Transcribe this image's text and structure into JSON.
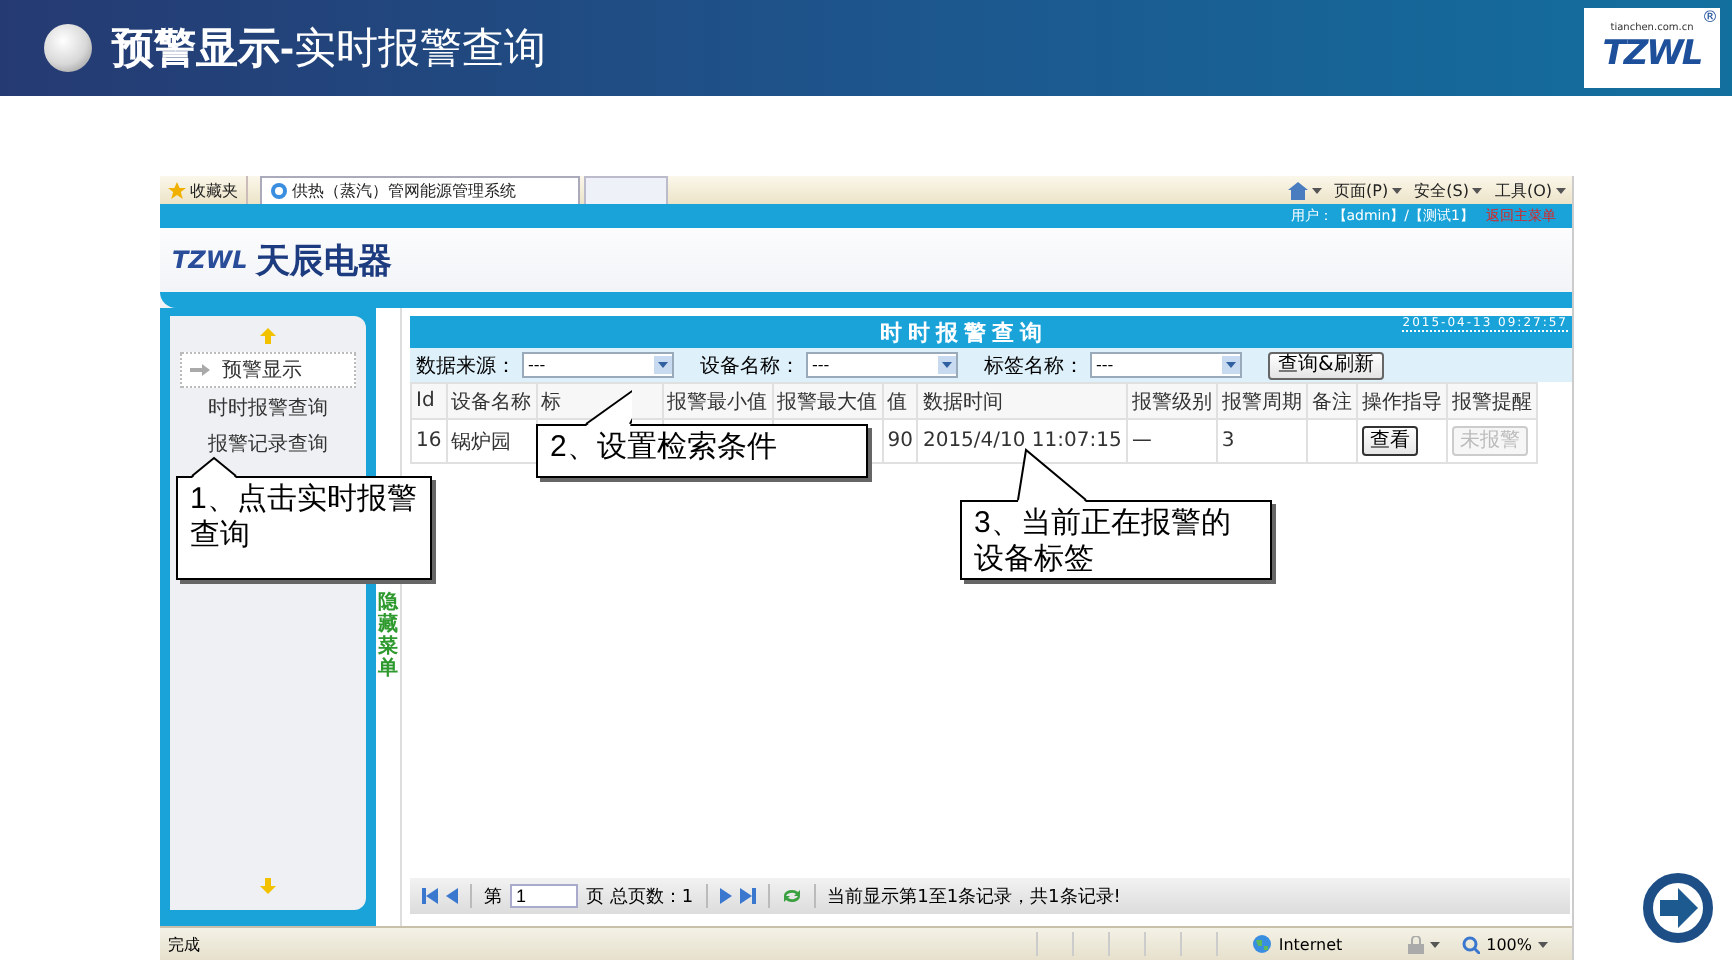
{
  "slide": {
    "title": "**预警显示-**实时报警查询",
    "logo": {
      "url": "tianchen.com.cn",
      "mark": "TZWL",
      "registered": "®"
    }
  },
  "browser": {
    "favorites": "收藏夹",
    "tab": {
      "title": "供热（蒸汽）管网能源管理系统",
      "selected": true
    },
    "menus": [
      "页面(P)",
      "安全(S)",
      "工具(O)"
    ],
    "status": "完成",
    "zone": "Internet",
    "zoom": "100%"
  },
  "app": {
    "logo_mark": "TZWL",
    "company": "天辰电器",
    "user": "用户：【admin】/【测试1】",
    "home_link": "返回主菜单",
    "sidebar": {
      "items": [
        {
          "label": "预警显示",
          "selected": true
        },
        {
          "label": "时时报警查询",
          "selected": false
        },
        {
          "label": "报警记录查询",
          "selected": false
        }
      ]
    },
    "hide_menu": "隐藏菜单",
    "panel": {
      "title": "时时报警查询",
      "timestamp": "2015-04-13 09:27:57",
      "filters": [
        {
          "label": "数据来源：",
          "value": "---"
        },
        {
          "label": "设备名称：",
          "value": "---"
        },
        {
          "label": "标签名称：",
          "value": "---"
        }
      ],
      "query_button": "查询&刷新",
      "table": {
        "columns": [
          "Id",
          "设备名称",
          "标",
          "报警最小值",
          "报警最大值",
          "值",
          "数据时间",
          "报警级别",
          "报警周期",
          "备注",
          "操作指导",
          "报警提醒"
        ],
        "rows": [
          {
            "cells": [
              "16",
              "锅炉园",
              null,
              null,
              null,
              "90",
              "2015/4/10 11:07:15",
              "一",
              "3",
              null
            ],
            "action": "查看",
            "alert": {
              "label": "未报警",
              "disabled": true
            }
          }
        ]
      },
      "pager": {
        "page_label": "第",
        "page": "1",
        "total": "页 总页数：1",
        "summary": "当前显示第1至1条记录，共1条记录!"
      }
    }
  },
  "callouts": [
    {
      "text": "1、点击实时报警查询"
    },
    {
      "text": "2、设置检索条件"
    },
    {
      "text": "3、当前正在报警的设备标签"
    }
  ]
}
